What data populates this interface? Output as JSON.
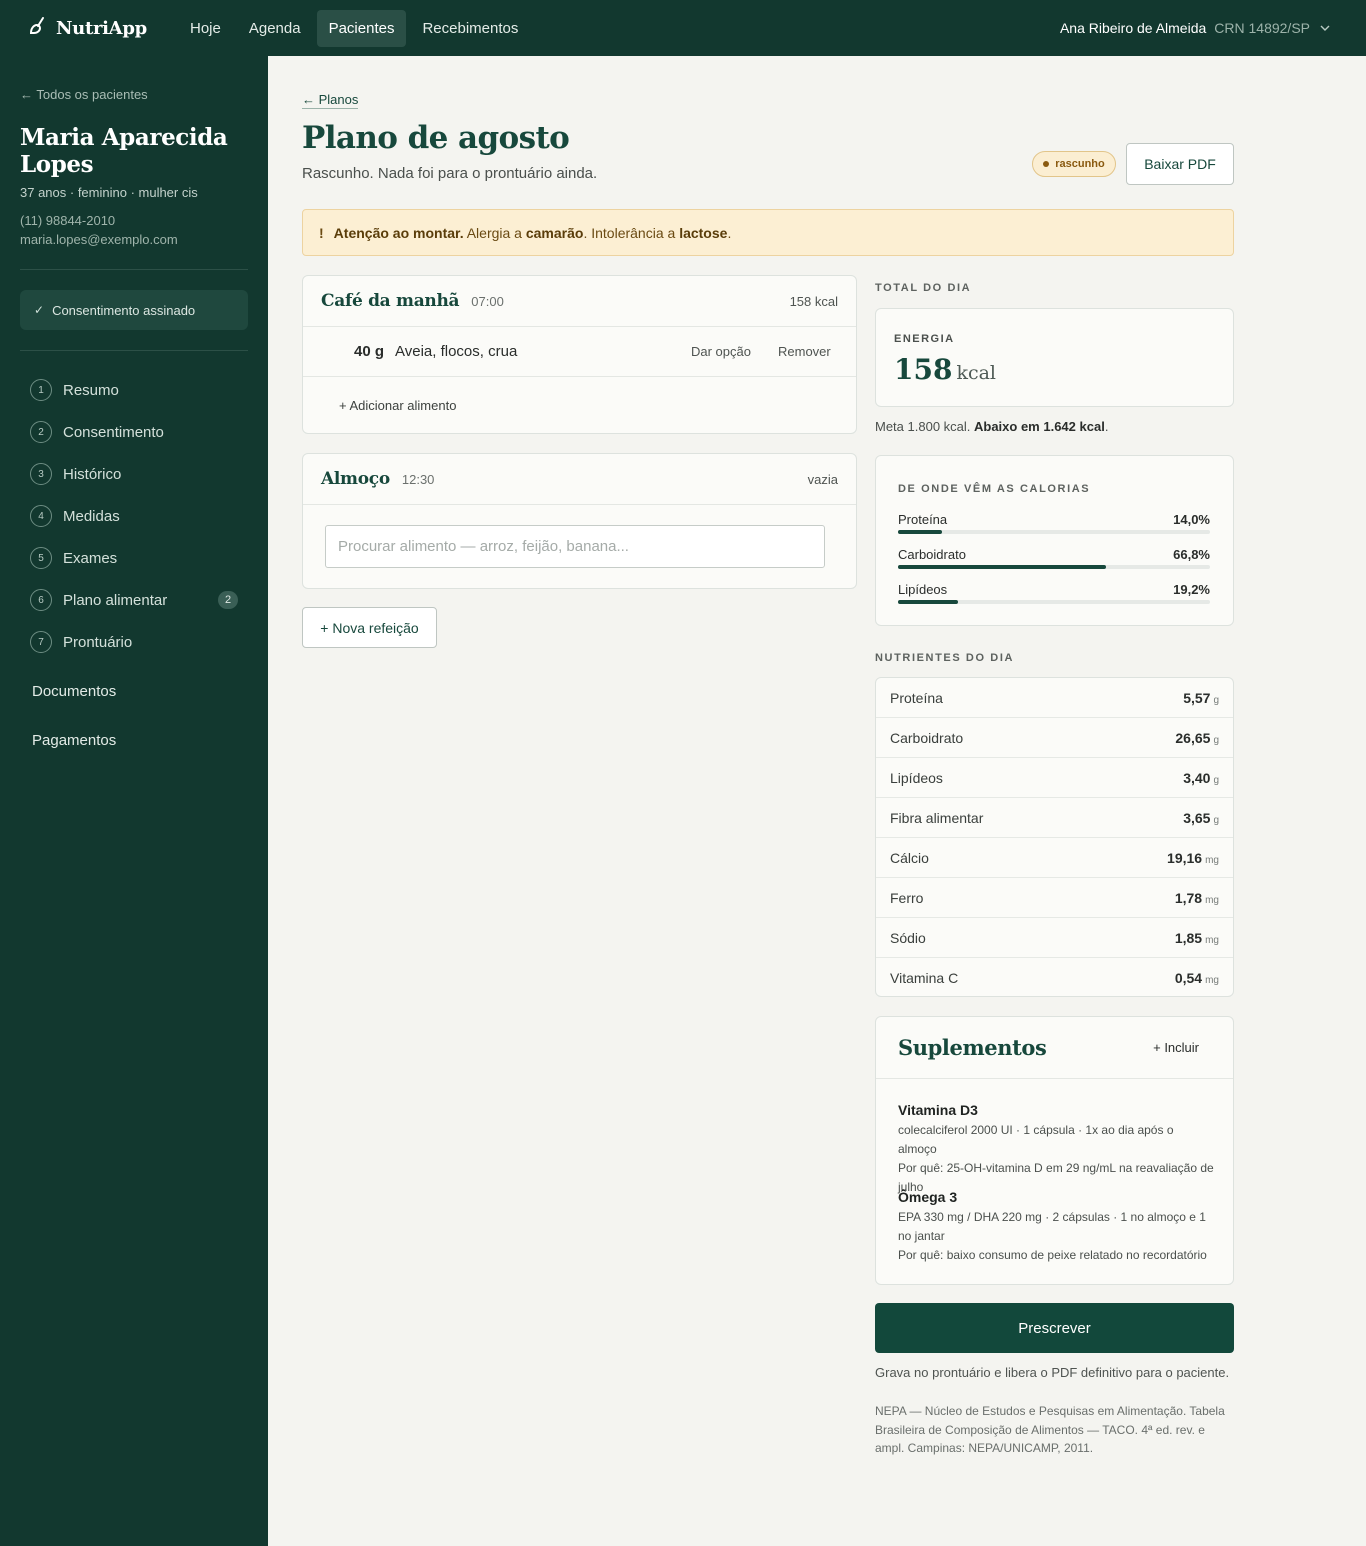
{
  "topbar": {
    "brand": "NutriApp",
    "nav": [
      "Hoje",
      "Agenda",
      "Pacientes",
      "Recebimentos"
    ],
    "active_nav": "Pacientes",
    "user_name": "Ana Ribeiro de Almeida",
    "user_crn": "CRN 14892/SP"
  },
  "sidebar": {
    "back_link": "← Todos os pacientes",
    "patient_name": "Maria Aparecida Lopes",
    "patient_meta": "37 anos · feminino · mulher cis",
    "phone": "(11) 98844-2010",
    "email": "maria.lopes@exemplo.com",
    "consent": "Consentimento assinado",
    "steps": [
      {
        "num": "1",
        "label": "Resumo"
      },
      {
        "num": "2",
        "label": "Consentimento"
      },
      {
        "num": "3",
        "label": "Histórico"
      },
      {
        "num": "4",
        "label": "Medidas"
      },
      {
        "num": "5",
        "label": "Exames"
      },
      {
        "num": "6",
        "label": "Plano alimentar",
        "badge": "2"
      },
      {
        "num": "7",
        "label": "Prontuário"
      }
    ],
    "documents": "Documentos",
    "payments": "Pagamentos"
  },
  "main": {
    "breadcrumb": "← Planos",
    "title": "Plano de agosto",
    "subtitle": "Rascunho. Nada foi para o prontuário ainda.",
    "status": "rascunho",
    "download_pdf": "Baixar PDF",
    "alert": {
      "mark": "!",
      "lead": "Atenção ao montar.",
      "text1": " Alergia a ",
      "allergen": "camarão",
      "text2": ". Intolerância a ",
      "intolerance": "lactose",
      "text3": "."
    },
    "breakfast": {
      "name": "Café da manhã",
      "time": "07:00",
      "kcal": "158 kcal",
      "food_qty": "40 g",
      "food_name": "Aveia, flocos, crua",
      "option": "Dar opção",
      "remove": "Remover",
      "add_food": "+ Adicionar alimento"
    },
    "lunch": {
      "name": "Almoço",
      "time": "12:30",
      "status": "vazia",
      "search_placeholder": "Procurar alimento — arroz, feijão, banana..."
    },
    "new_meal": "+ Nova refeição"
  },
  "summary": {
    "total_label": "TOTAL DO DIA",
    "energy_label": "ENERGIA",
    "energy_value": "158",
    "energy_unit": "kcal",
    "meta_text": "Meta 1.800 kcal. ",
    "meta_bold": "Abaixo em 1.642 kcal",
    "meta_end": ".",
    "calories_label": "DE ONDE VÊM AS CALORIAS",
    "macros": [
      {
        "name": "Proteína",
        "pct": "14,0%",
        "value": 14.0
      },
      {
        "name": "Carboidrato",
        "pct": "66,8%",
        "value": 66.8
      },
      {
        "name": "Lipídeos",
        "pct": "19,2%",
        "value": 19.2
      }
    ],
    "nutrients_label": "NUTRIENTES DO DIA",
    "nutrients": [
      {
        "name": "Proteína",
        "value": "5,57",
        "unit": "g"
      },
      {
        "name": "Carboidrato",
        "value": "26,65",
        "unit": "g"
      },
      {
        "name": "Lipídeos",
        "value": "3,40",
        "unit": "g"
      },
      {
        "name": "Fibra alimentar",
        "value": "3,65",
        "unit": "g"
      },
      {
        "name": "Cálcio",
        "value": "19,16",
        "unit": "mg"
      },
      {
        "name": "Ferro",
        "value": "1,78",
        "unit": "mg"
      },
      {
        "name": "Sódio",
        "value": "1,85",
        "unit": "mg"
      },
      {
        "name": "Vitamina C",
        "value": "0,54",
        "unit": "mg"
      }
    ]
  },
  "supplements": {
    "title": "Suplementos",
    "add": "+ Incluir",
    "items": [
      {
        "name": "Vitamina D3",
        "dose": "colecalciferol 2000 UI · 1 cápsula · 1x ao dia após o almoço",
        "why": "Por quê: 25-OH-vitamina D em 29 ng/mL na reavaliação de julho"
      },
      {
        "name": "Ômega 3",
        "dose": "EPA 330 mg / DHA 220 mg · 2 cápsulas · 1 no almoço e 1 no jantar",
        "why": "Por quê: baixo consumo de peixe relatado no recordatório"
      }
    ]
  },
  "prescribe": {
    "button": "Prescrever",
    "note": "Grava no prontuário e libera o PDF definitivo para o paciente.",
    "reference": "NEPA — Núcleo de Estudos e Pesquisas em Alimentação. Tabela Brasileira de Composição de Alimentos — TACO. 4ª ed. rev. e ampl. Campinas: NEPA/UNICAMP, 2011."
  },
  "colors": {
    "primary": "#12382f",
    "accent": "#17483c",
    "warning_bg": "#fcefd3"
  },
  "icons": [
    "leaf-logo-icon",
    "chevron-down-icon",
    "check-icon"
  ]
}
